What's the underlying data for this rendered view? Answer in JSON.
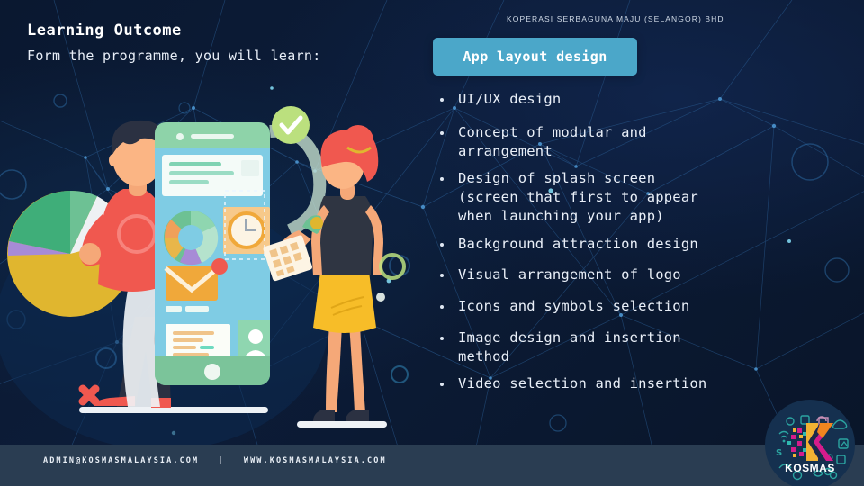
{
  "slide": {
    "title": "Learning Outcome",
    "subtitle": "Form the programme, you will learn:"
  },
  "badge": {
    "label": "App layout design",
    "color": "#4ba7c9"
  },
  "bullets": [
    {
      "lines": [
        "UI/UX design"
      ]
    },
    {
      "lines": [
        "Concept of modular and",
        "arrangement"
      ]
    },
    {
      "lines": [
        "Design of splash screen",
        "(screen that first to appear",
        "when launching your app)"
      ]
    },
    {
      "lines": [
        "Background attraction design"
      ]
    },
    {
      "lines": [
        "Visual arrangement of logo"
      ]
    },
    {
      "lines": [
        "Icons and symbols selection"
      ]
    },
    {
      "lines": [
        "Image design and insertion",
        "method"
      ]
    },
    {
      "lines": [
        "Video selection and insertion"
      ]
    }
  ],
  "footer": {
    "email": "ADMIN@KOSMASMALAYSIA.COM",
    "separator": "|",
    "website": "WWW.KOSMASMALAYSIA.COM",
    "organisation": "KOPERASI SERBAGUNA MAJU (SELANGOR) BHD",
    "background": "#2a3d52"
  },
  "logo": {
    "wordmark": "KOSMAS"
  },
  "theme": {
    "background_dark": "#0a1830",
    "text_primary": "#ffffff",
    "text_body": "#e9eff8",
    "accent_teal": "#4ba7c9"
  }
}
